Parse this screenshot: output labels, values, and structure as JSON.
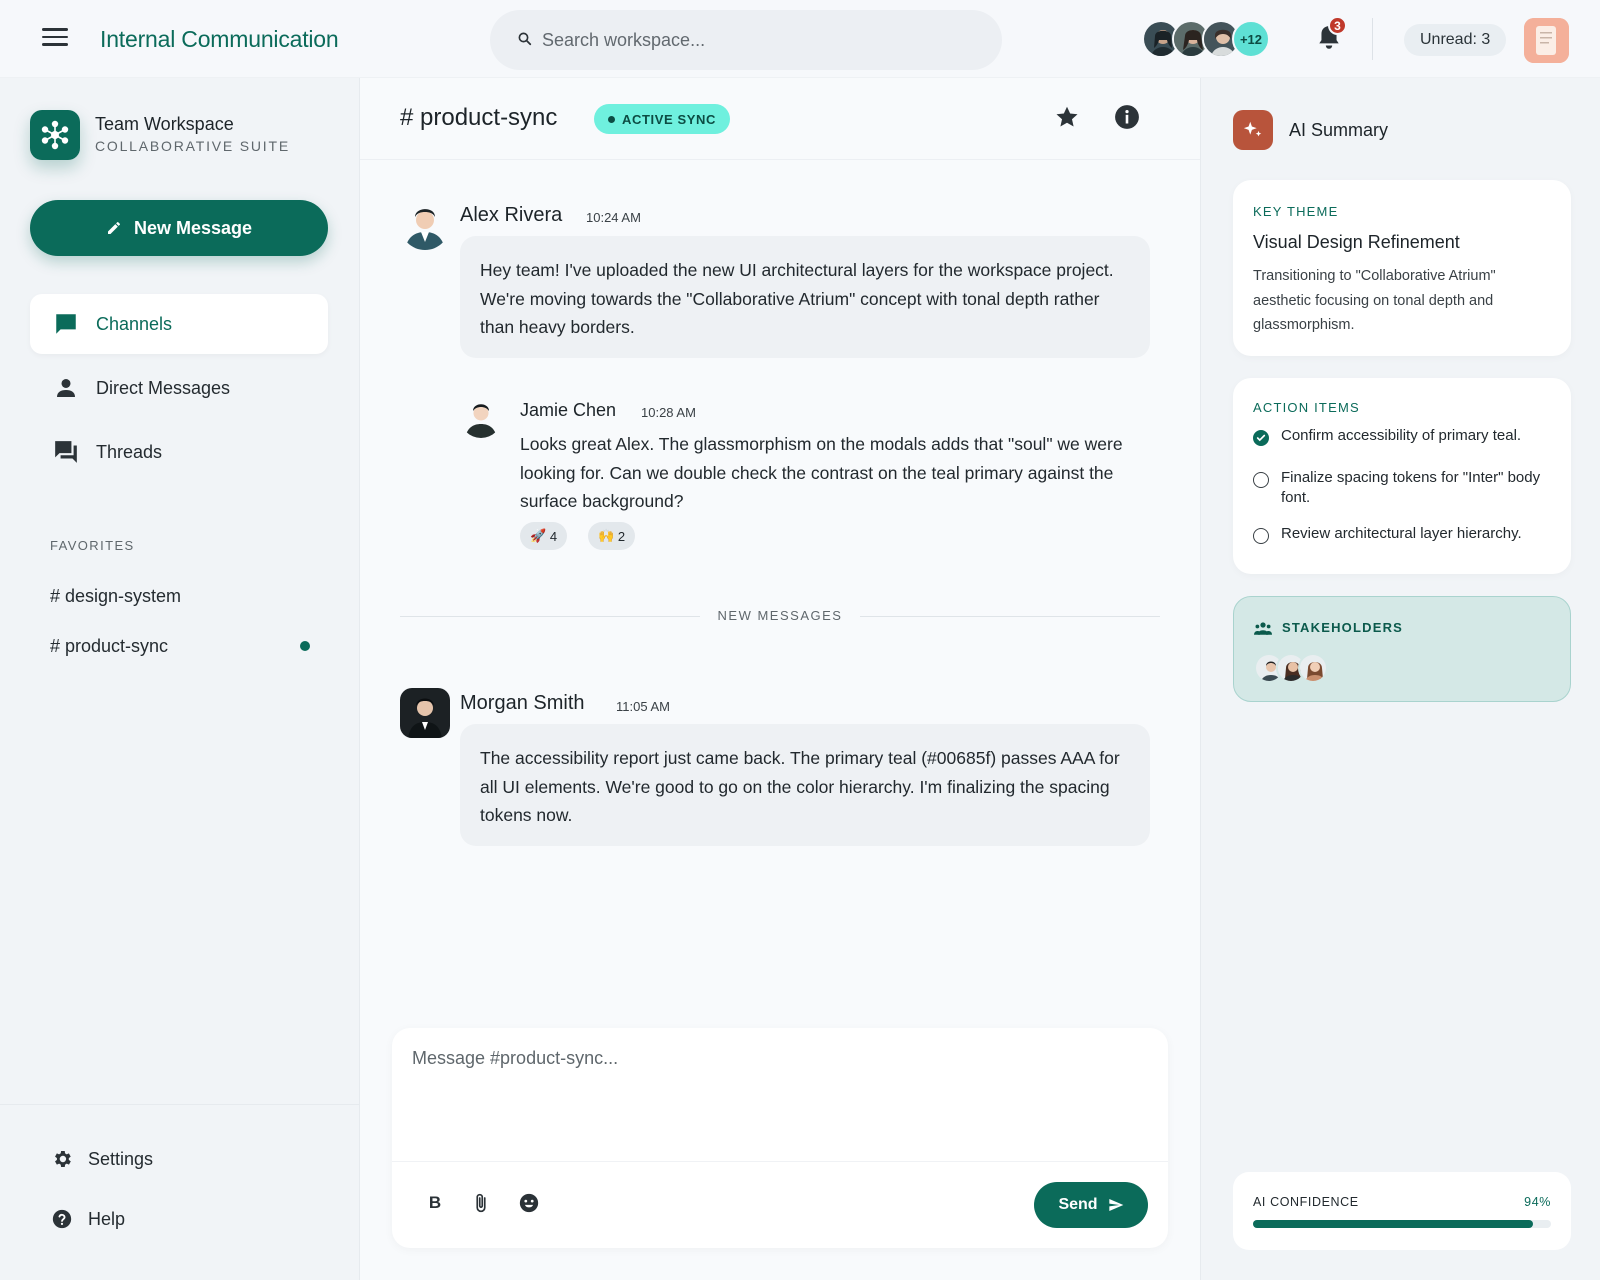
{
  "header": {
    "app_title": "Internal Communication",
    "search_placeholder": "Search workspace...",
    "avatars_more": "+12",
    "notifications_count": "3",
    "unread_label": "Unread: 3"
  },
  "sidebar": {
    "workspace_name": "Team Workspace",
    "workspace_subtitle": "COLLABORATIVE SUITE",
    "new_message_label": "New Message",
    "nav": [
      {
        "label": "Channels",
        "icon": "chat-bubble-icon",
        "active": true
      },
      {
        "label": "Direct Messages",
        "icon": "person-icon",
        "active": false
      },
      {
        "label": "Threads",
        "icon": "threads-icon",
        "active": false
      }
    ],
    "favorites_label": "FAVORITES",
    "favorites": [
      {
        "label": "# design-system",
        "unread": false
      },
      {
        "label": "# product-sync",
        "unread": true
      }
    ],
    "bottom": [
      {
        "label": "Settings",
        "icon": "gear-icon"
      },
      {
        "label": "Help",
        "icon": "help-icon"
      }
    ]
  },
  "channel": {
    "title": "# product-sync",
    "status_badge": "ACTIVE SYNC",
    "messages": [
      {
        "author": "Alex Rivera",
        "time": "10:24 AM",
        "text": "Hey team! I've uploaded the new UI architectural layers for the workspace project. We're moving towards the \"Collaborative Atrium\" concept with tonal depth rather than heavy borders."
      },
      {
        "author": "Jamie Chen",
        "time": "10:28 AM",
        "text": "Looks great Alex. The glassmorphism on the modals adds that \"soul\" we were looking for. Can we double check the contrast on the teal primary against the surface background?",
        "reactions": [
          {
            "emoji": "🚀",
            "count": "4"
          },
          {
            "emoji": "🙌",
            "count": "2"
          }
        ]
      },
      {
        "author": "Morgan Smith",
        "time": "11:05 AM",
        "text": "The accessibility report just came back. The primary teal (#00685f) passes AAA for all UI elements. We're good to go on the color hierarchy. I'm finalizing the spacing tokens now."
      }
    ],
    "new_messages_label": "NEW MESSAGES",
    "composer_placeholder": "Message #product-sync...",
    "send_label": "Send",
    "bold_label": "B"
  },
  "ai_panel": {
    "title": "AI Summary",
    "key_theme_label": "KEY THEME",
    "key_theme_heading": "Visual Design Refinement",
    "key_theme_body": "Transitioning to \"Collaborative Atrium\" aesthetic focusing on tonal depth and glassmorphism.",
    "action_items_label": "ACTION ITEMS",
    "action_items": [
      {
        "text": "Confirm accessibility of primary teal.",
        "done": true
      },
      {
        "text": "Finalize spacing tokens for \"Inter\" body font.",
        "done": false
      },
      {
        "text": "Review architectural layer hierarchy.",
        "done": false
      }
    ],
    "stakeholders_label": "STAKEHOLDERS",
    "confidence_label": "AI CONFIDENCE",
    "confidence_value": "94%",
    "confidence_fraction": 0.94
  },
  "colors": {
    "primary": "#0b6b5a",
    "accent": "#6ff0de",
    "ai_icon": "#b8543b",
    "badge_red": "#c0392b"
  }
}
